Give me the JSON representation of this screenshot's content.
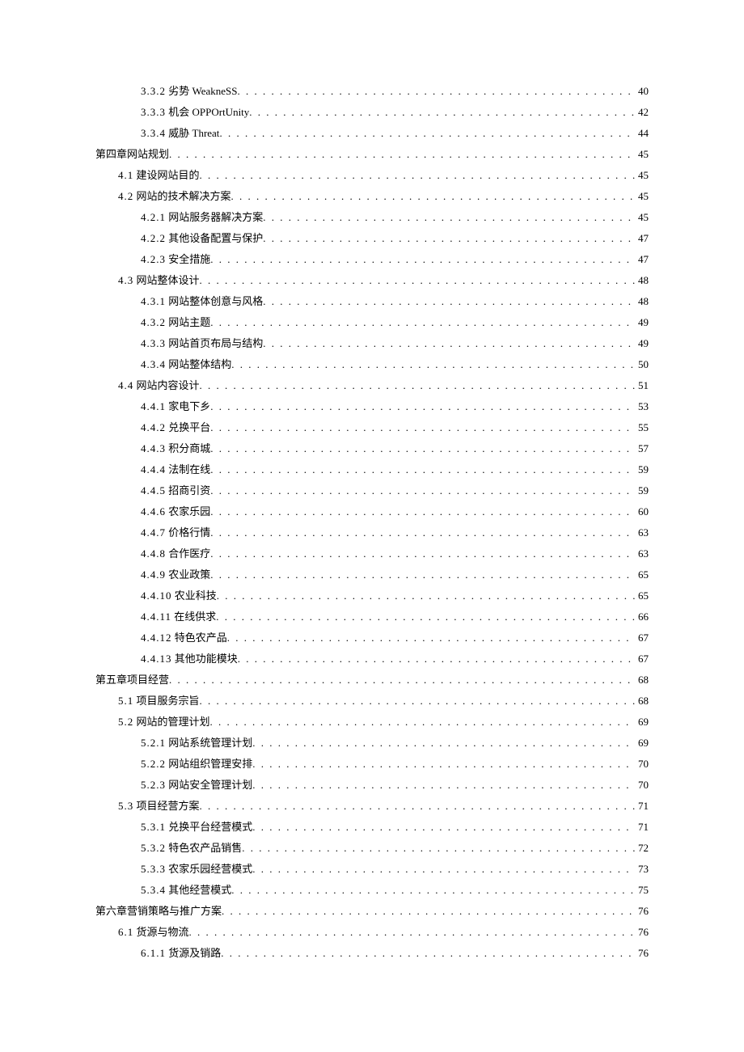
{
  "toc": [
    {
      "level": 2,
      "num": "3.3.2",
      "title": "劣势 WeakneSS",
      "page": 40
    },
    {
      "level": 2,
      "num": "3.3.3",
      "title": "机会 OPPOrtUnity",
      "page": 42
    },
    {
      "level": 2,
      "num": "3.3.4",
      "title": "威胁 Threat",
      "page": 44
    },
    {
      "level": 0,
      "num": "",
      "title": "第四章网站规划",
      "page": 45
    },
    {
      "level": 1,
      "num": "4.1",
      "title": "建设网站目的",
      "page": 45
    },
    {
      "level": 1,
      "num": "4.2",
      "title": "网站的技术解决方案",
      "page": 45
    },
    {
      "level": 2,
      "num": "4.2.1",
      "title": "网站服务器解决方案",
      "page": 45
    },
    {
      "level": 2,
      "num": "4.2.2",
      "title": "其他设备配置与保护",
      "page": 47
    },
    {
      "level": 2,
      "num": "4.2.3",
      "title": "安全措施",
      "page": 47
    },
    {
      "level": 1,
      "num": "4.3",
      "title": "网站整体设计",
      "page": 48
    },
    {
      "level": 2,
      "num": "4.3.1",
      "title": "网站整体创意与风格",
      "page": 48
    },
    {
      "level": 2,
      "num": "4.3.2",
      "title": "网站主题",
      "page": 49
    },
    {
      "level": 2,
      "num": "4.3.3",
      "title": "网站首页布局与结构",
      "page": 49
    },
    {
      "level": 2,
      "num": "4.3.4",
      "title": "网站整体结构",
      "page": 50
    },
    {
      "level": 1,
      "num": "4.4",
      "title": "网站内容设计",
      "page": 51
    },
    {
      "level": 2,
      "num": "4.4.1",
      "title": "家电下乡",
      "page": 53
    },
    {
      "level": 2,
      "num": "4.4.2",
      "title": "兑换平台",
      "page": 55
    },
    {
      "level": 2,
      "num": "4.4.3",
      "title": "积分商城",
      "page": 57
    },
    {
      "level": 2,
      "num": "4.4.4",
      "title": "法制在线",
      "page": 59
    },
    {
      "level": 2,
      "num": "4.4.5",
      "title": "招商引资",
      "page": 59
    },
    {
      "level": 2,
      "num": "4.4.6",
      "title": "农家乐园",
      "page": 60
    },
    {
      "level": 2,
      "num": "4.4.7",
      "title": "价格行情",
      "page": 63
    },
    {
      "level": 2,
      "num": "4.4.8",
      "title": "合作医疗",
      "page": 63
    },
    {
      "level": 2,
      "num": "4.4.9",
      "title": "农业政策",
      "page": 65
    },
    {
      "level": 2,
      "num": "4.4.10",
      "title": " 农业科技",
      "page": 65
    },
    {
      "level": 2,
      "num": "4.4.11",
      "title": "在线供求",
      "page": 66
    },
    {
      "level": 2,
      "num": "4.4.12",
      "title": "特色农产品",
      "page": 67
    },
    {
      "level": 2,
      "num": "4.4.13",
      "title": "其他功能模块",
      "page": 67
    },
    {
      "level": 0,
      "num": "",
      "title": "第五章项目经营",
      "page": 68
    },
    {
      "level": 1,
      "num": "5.1",
      "title": "项目服务宗旨",
      "page": 68
    },
    {
      "level": 1,
      "num": "5.2",
      "title": "网站的管理计划",
      "page": 69
    },
    {
      "level": 2,
      "num": "5.2.1",
      "title": "网站系统管理计划",
      "page": 69
    },
    {
      "level": 2,
      "num": "5.2.2",
      "title": "网站组织管理安排",
      "page": 70
    },
    {
      "level": 2,
      "num": "5.2.3",
      "title": "网站安全管理计划",
      "page": 70
    },
    {
      "level": 1,
      "num": "5.3",
      "title": "项目经营方案",
      "page": 71
    },
    {
      "level": 2,
      "num": "5.3.1",
      "title": "兑换平台经营模式",
      "page": 71
    },
    {
      "level": 2,
      "num": "5.3.2",
      "title": "特色农产品销售",
      "page": 72
    },
    {
      "level": 2,
      "num": "5.3.3",
      "title": "农家乐园经营模式",
      "page": 73
    },
    {
      "level": 2,
      "num": "5.3.4",
      "title": "其他经营模式",
      "page": 75
    },
    {
      "level": 0,
      "num": "",
      "title": "第六章营销策略与推广方案",
      "page": 76
    },
    {
      "level": 1,
      "num": "6.1",
      "title": "货源与物流",
      "page": 76
    },
    {
      "level": 2,
      "num": "6.1.1",
      "title": "货源及销路",
      "page": 76
    }
  ]
}
